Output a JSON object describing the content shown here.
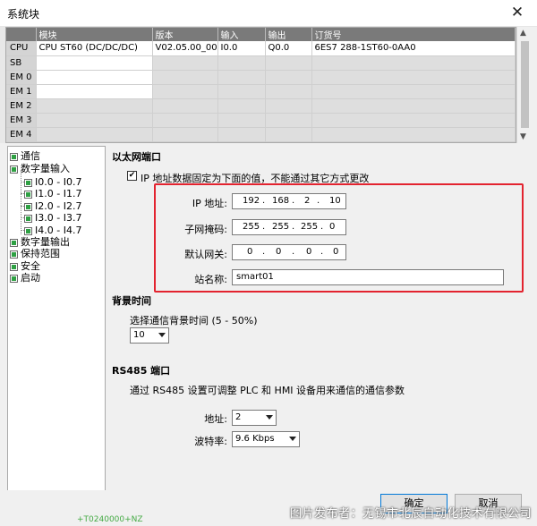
{
  "window": {
    "title": "系统块",
    "close_glyph": "✕"
  },
  "module_table": {
    "headers": [
      "",
      "模块",
      "版本",
      "输入",
      "输出",
      "订货号"
    ],
    "rows": [
      {
        "slot": "CPU",
        "module": "CPU ST60 (DC/DC/DC)",
        "version": "V02.05.00_00...",
        "input": "I0.0",
        "output": "Q0.0",
        "order": "6ES7 288-1ST60-0AA0"
      },
      {
        "slot": "SB",
        "module": "",
        "version": "",
        "input": "",
        "output": "",
        "order": ""
      },
      {
        "slot": "EM 0",
        "module": "",
        "version": "",
        "input": "",
        "output": "",
        "order": ""
      },
      {
        "slot": "EM 1",
        "module": "",
        "version": "",
        "input": "",
        "output": "",
        "order": ""
      },
      {
        "slot": "EM 2",
        "module": "",
        "version": "",
        "input": "",
        "output": "",
        "order": ""
      },
      {
        "slot": "EM 3",
        "module": "",
        "version": "",
        "input": "",
        "output": "",
        "order": ""
      },
      {
        "slot": "EM 4",
        "module": "",
        "version": "",
        "input": "",
        "output": "",
        "order": ""
      }
    ]
  },
  "tree": {
    "items": [
      {
        "label": "通信"
      },
      {
        "label": "数字量输入"
      },
      {
        "label": "I0.0 - I0.7"
      },
      {
        "label": "I1.0 - I1.7"
      },
      {
        "label": "I2.0 - I2.7"
      },
      {
        "label": "I3.0 - I3.7"
      },
      {
        "label": "I4.0 - I4.7"
      },
      {
        "label": "数字量输出"
      },
      {
        "label": "保持范围"
      },
      {
        "label": "安全"
      },
      {
        "label": "启动"
      }
    ]
  },
  "ethernet": {
    "title": "以太网端口",
    "fixed_ip_label": "IP 地址数据固定为下面的值，不能通过其它方式更改",
    "fixed_ip_checked": "✔",
    "ip_label": "IP 地址:",
    "ip": [
      "192",
      "168",
      "2",
      "10"
    ],
    "mask_label": "子网掩码:",
    "mask": [
      "255",
      "255",
      "255",
      "0"
    ],
    "gateway_label": "默认网关:",
    "gateway": [
      "0",
      "0",
      "0",
      "0"
    ],
    "station_label": "站名称:",
    "station_value": "smart01",
    "dot": "."
  },
  "background_time": {
    "title": "背景时间",
    "desc": "选择通信背景时间 (5 - 50%)",
    "value": "10"
  },
  "rs485": {
    "title": "RS485 端口",
    "desc": "通过 RS485 设置可调整 PLC 和 HMI 设备用来通信的通信参数",
    "address_label": "地址:",
    "address_value": "2",
    "baud_label": "波特率:",
    "baud_value": "9.6 Kbps"
  },
  "buttons": {
    "ok": "确定",
    "cancel": "取消"
  },
  "watermark": "图片发布者：无锡市北辰自动化技术有限公司",
  "background_fragment": "+T0240000+NZ",
  "colors": {
    "highlight_box": "#e3232f",
    "check_green": "#2ea043",
    "table_header": "#7a7a7a"
  }
}
